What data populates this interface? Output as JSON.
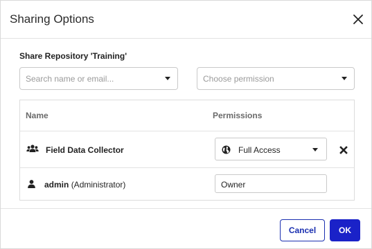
{
  "dialog": {
    "title": "Sharing Options",
    "section_label": "Share Repository 'Training'",
    "user_select": {
      "placeholder": "Search name or email..."
    },
    "permission_select": {
      "placeholder": "Choose permission"
    },
    "table": {
      "headers": {
        "name": "Name",
        "permissions": "Permissions"
      },
      "rows": [
        {
          "name": "Field Data Collector",
          "suffix": "",
          "icon": "users-group-icon",
          "permission": "Full Access",
          "permission_icon": "globe-icon",
          "removable": true
        },
        {
          "name": "admin",
          "suffix": "(Administrator)",
          "icon": "user-icon",
          "permission": "Owner",
          "removable": false
        }
      ]
    },
    "buttons": {
      "cancel": "Cancel",
      "ok": "OK"
    },
    "colors": {
      "primary": "#1a22c8",
      "border": "#c9c9c9"
    }
  }
}
